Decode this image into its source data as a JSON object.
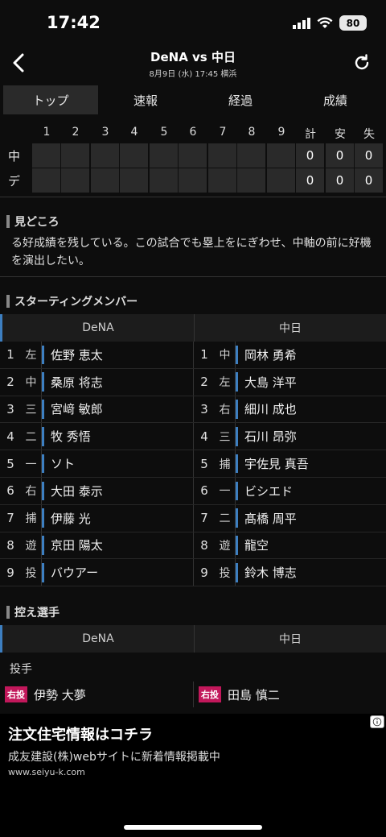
{
  "status": {
    "time": "17:42",
    "battery": "80"
  },
  "nav": {
    "title": "DeNA vs 中日",
    "subtitle": "8月9日 (水) 17:45 横浜"
  },
  "tabs": [
    "トップ",
    "速報",
    "経過",
    "成績"
  ],
  "scoreboard": {
    "innings": [
      "1",
      "2",
      "3",
      "4",
      "5",
      "6",
      "7",
      "8",
      "9"
    ],
    "total_labels": [
      "計",
      "安",
      "失"
    ],
    "rows": [
      {
        "team": "中",
        "totals": [
          "0",
          "0",
          "0"
        ]
      },
      {
        "team": "デ",
        "totals": [
          "0",
          "0",
          "0"
        ]
      }
    ]
  },
  "highlights": {
    "heading": "見どころ",
    "text": "る好成績を残している。この試合でも塁上をにぎわせ、中軸の前に好機を演出したい。"
  },
  "starting": {
    "heading": "スターティングメンバー",
    "teams": [
      "DeNA",
      "中日"
    ],
    "rows": [
      {
        "order": "1",
        "home_pos": "左",
        "home": "佐野 恵太",
        "away_pos": "中",
        "away": "岡林 勇希"
      },
      {
        "order": "2",
        "home_pos": "中",
        "home": "桑原 将志",
        "away_pos": "左",
        "away": "大島 洋平"
      },
      {
        "order": "3",
        "home_pos": "三",
        "home": "宮﨑 敏郎",
        "away_pos": "右",
        "away": "細川 成也"
      },
      {
        "order": "4",
        "home_pos": "二",
        "home": "牧 秀悟",
        "away_pos": "三",
        "away": "石川 昂弥"
      },
      {
        "order": "5",
        "home_pos": "一",
        "home": "ソト",
        "away_pos": "捕",
        "away": "宇佐見 真吾"
      },
      {
        "order": "6",
        "home_pos": "右",
        "home": "大田 泰示",
        "away_pos": "一",
        "away": "ビシエド"
      },
      {
        "order": "7",
        "home_pos": "捕",
        "home": "伊藤 光",
        "away_pos": "二",
        "away": "髙橋 周平"
      },
      {
        "order": "8",
        "home_pos": "遊",
        "home": "京田 陽太",
        "away_pos": "遊",
        "away": "龍空"
      },
      {
        "order": "9",
        "home_pos": "投",
        "home": "バウアー",
        "away_pos": "投",
        "away": "鈴木 博志"
      }
    ]
  },
  "bench": {
    "heading": "控え選手",
    "teams": [
      "DeNA",
      "中日"
    ],
    "category": "投手",
    "rows": [
      {
        "home_badge": "右投",
        "home": "伊勢 大夢",
        "away_badge": "右投",
        "away": "田島 慎二"
      }
    ]
  },
  "ad": {
    "title": "注文住宅情報はコチラ",
    "desc": "成友建設(株)webサイトに新着情報掲載中",
    "url": "www.seiyu-k.com"
  }
}
